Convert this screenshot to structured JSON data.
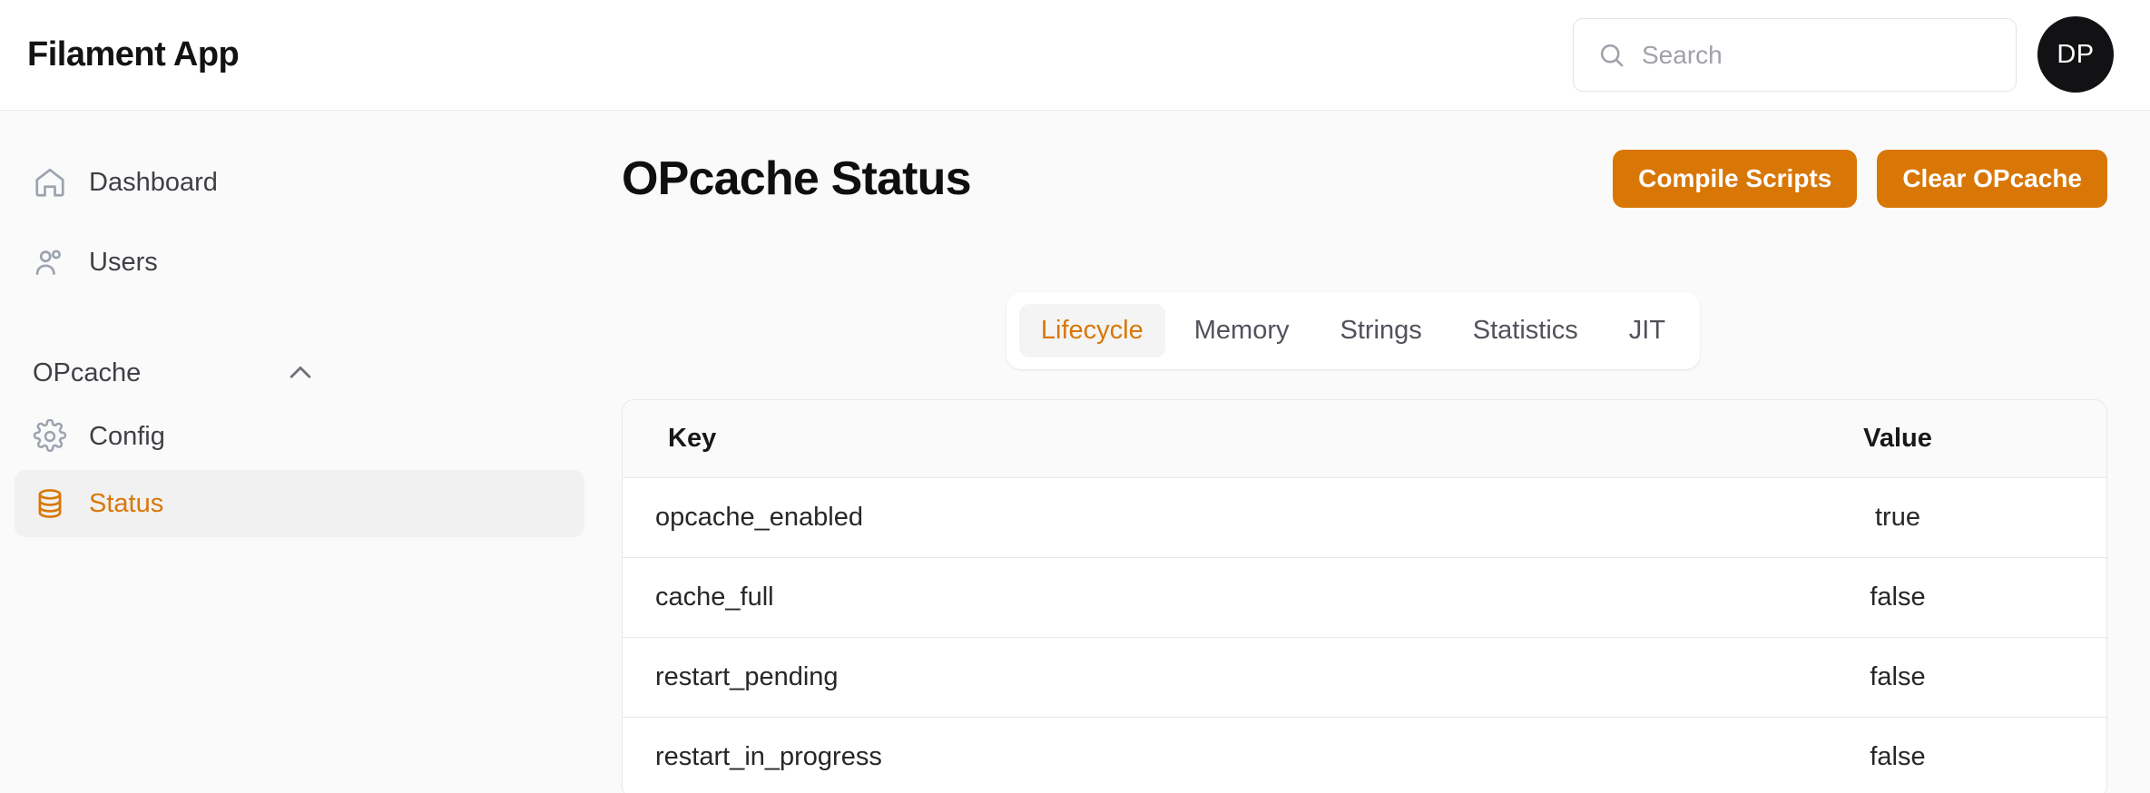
{
  "topbar": {
    "brand": "Filament App",
    "search": {
      "placeholder": "Search",
      "value": "",
      "icon": "search-icon"
    },
    "avatar": {
      "initials": "DP",
      "background": "#121214"
    }
  },
  "sidebar": {
    "items": [
      {
        "label": "Dashboard",
        "icon": "home-icon",
        "active": false
      },
      {
        "label": "Users",
        "icon": "users-icon",
        "active": false
      }
    ],
    "group": {
      "label": "OPcache",
      "collapse_icon": "chevron-up-icon",
      "items": [
        {
          "label": "Config",
          "icon": "gear-icon",
          "active": false
        },
        {
          "label": "Status",
          "icon": "database-icon",
          "active": true
        }
      ]
    }
  },
  "main": {
    "page_title": "OPcache Status",
    "actions": [
      {
        "label": "Compile Scripts"
      },
      {
        "label": "Clear OPcache"
      }
    ],
    "tabs": [
      {
        "label": "Lifecycle",
        "active": true
      },
      {
        "label": "Memory",
        "active": false
      },
      {
        "label": "Strings",
        "active": false
      },
      {
        "label": "Statistics",
        "active": false
      },
      {
        "label": "JIT",
        "active": false
      }
    ],
    "table": {
      "columns": [
        "Key",
        "Value"
      ],
      "rows": [
        {
          "key": "opcache_enabled",
          "value": "true"
        },
        {
          "key": "cache_full",
          "value": "false"
        },
        {
          "key": "restart_pending",
          "value": "false"
        },
        {
          "key": "restart_in_progress",
          "value": "false"
        }
      ]
    }
  },
  "colors": {
    "accent": "#d97706",
    "page_background": "#fafafa",
    "surface": "#ffffff",
    "border": "#e8e8ea",
    "text": "#18181b",
    "muted_text": "#71717a"
  }
}
